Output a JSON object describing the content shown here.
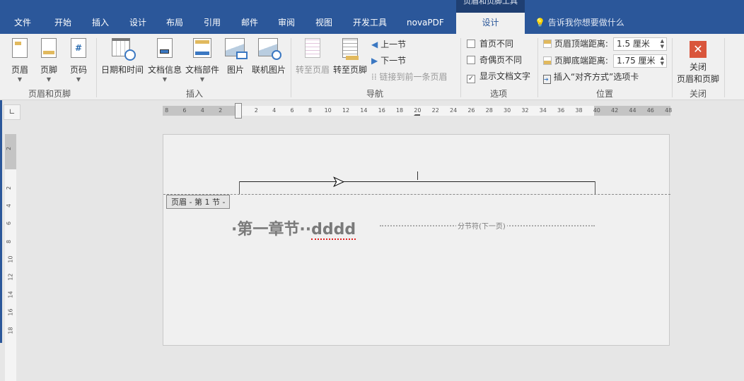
{
  "title_bar": {
    "contextual_title": "页眉和页脚工具"
  },
  "tabs": [
    "文件",
    "开始",
    "插入",
    "设计",
    "布局",
    "引用",
    "邮件",
    "审阅",
    "视图",
    "开发工具",
    "novaPDF"
  ],
  "active_tab": "设计",
  "tell_me": "告诉我你想要做什么",
  "groups": {
    "header_footer": {
      "label": "页眉和页脚",
      "buttons": [
        "页眉",
        "页脚",
        "页码"
      ]
    },
    "insert": {
      "label": "插入",
      "buttons": [
        "日期和时间",
        "文档信息",
        "文档部件",
        "图片",
        "联机图片"
      ]
    },
    "navigation": {
      "label": "导航",
      "goto_header": "转至页眉",
      "goto_footer": "转至页脚",
      "prev": "上一节",
      "next": "下一节",
      "link_prev": "链接到前一条页眉"
    },
    "options": {
      "label": "选项",
      "items": [
        {
          "label": "首页不同",
          "checked": false
        },
        {
          "label": "奇偶页不同",
          "checked": false
        },
        {
          "label": "显示文档文字",
          "checked": true
        }
      ]
    },
    "position": {
      "label": "位置",
      "header_top_label": "页眉顶端距离:",
      "header_top_value": "1.5 厘米",
      "footer_bottom_label": "页脚底端距离:",
      "footer_bottom_value": "1.75 厘米",
      "insert_align": "插入“对齐方式”选项卡"
    },
    "close": {
      "label": "关闭",
      "button_line1": "关闭",
      "button_line2": "页眉和页脚"
    }
  },
  "ruler": {
    "left_labels": [
      "8",
      "6",
      "4",
      "2"
    ],
    "main_labels": [
      "2",
      "4",
      "6",
      "8",
      "10",
      "12",
      "14",
      "16",
      "18",
      "20",
      "22",
      "24",
      "26",
      "28",
      "30",
      "32",
      "34",
      "36",
      "38"
    ],
    "right_labels": [
      "40",
      "42",
      "44",
      "46",
      "48"
    ],
    "vertical_top": [
      "2"
    ],
    "vertical": [
      "2",
      "4",
      "6",
      "8",
      "10",
      "12",
      "14",
      "16",
      "18"
    ]
  },
  "document": {
    "header_tag": "页眉 - 第 1 节 -",
    "heading_prefix": "·第一章节··",
    "heading_word": "dddd",
    "section_break": "分节符(下一页)"
  },
  "colors": {
    "accent": "#2b579a",
    "close_red": "#d9553b"
  }
}
